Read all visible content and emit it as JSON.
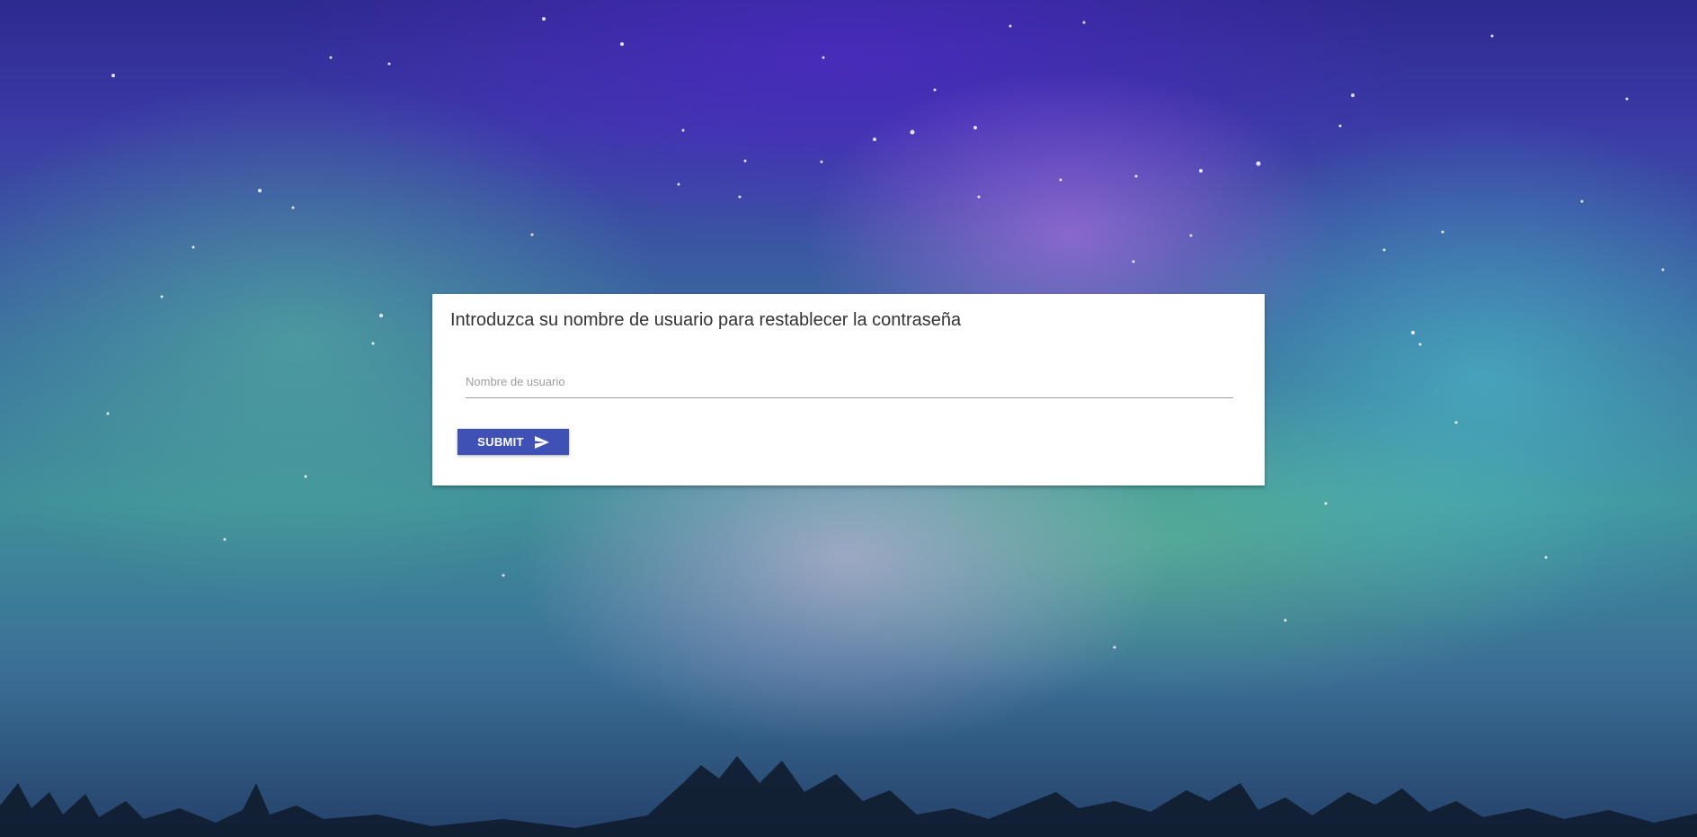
{
  "reset_form": {
    "title": "Introduzca su nombre de usuario para restablecer la contraseña",
    "username_label": "Nombre de usuario",
    "username_value": "",
    "submit_label": "SUBMIT",
    "submit_icon": "send-icon"
  },
  "colors": {
    "button": "#3f51b5",
    "card": "#ffffff",
    "title_text": "#333333",
    "label_text": "#9e9e9e"
  }
}
